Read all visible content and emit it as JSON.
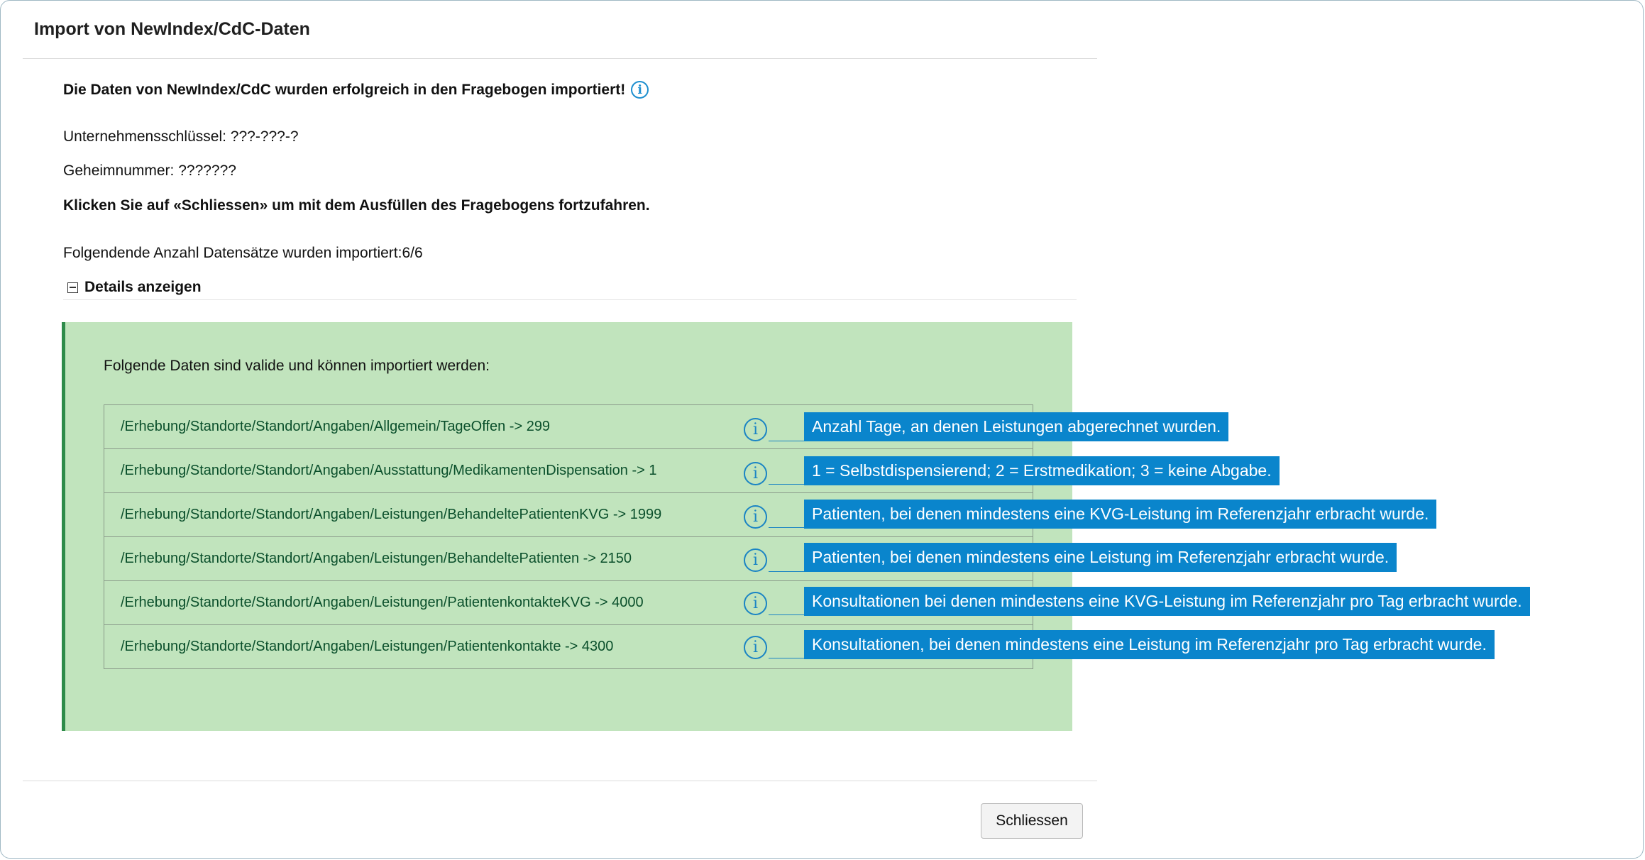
{
  "dialog": {
    "title": "Import von NewIndex/CdC-Daten"
  },
  "summary": {
    "success_message": "Die Daten von NewIndex/CdC wurden erfolgreich in den Fragebogen importiert!",
    "company_key": "Unternehmensschlüssel: ???-???-?",
    "secret_number": "Geheimnummer: ???????",
    "hint": "Klicken Sie auf «Schliessen» um mit dem Ausfüllen des Fragebogens fortzufahren.",
    "record_count": "Folgendende Anzahl Datensätze wurden importiert:6/6"
  },
  "details": {
    "toggle_label": "Details anzeigen",
    "valid_heading": "Folgende Daten sind valide und können importiert werden:",
    "rows": [
      {
        "path": "/Erhebung/Standorte/Standort/Angaben/Allgemein/TageOffen -> 299",
        "tooltip": "Anzahl Tage, an denen Leistungen abgerechnet wurden."
      },
      {
        "path": "/Erhebung/Standorte/Standort/Angaben/Ausstattung/MedikamentenDispensation -> 1",
        "tooltip": "1 = Selbstdispensierend; 2 = Erstmedikation; 3 = keine Abgabe."
      },
      {
        "path": "/Erhebung/Standorte/Standort/Angaben/Leistungen/BehandeltePatientenKVG -> 1999",
        "tooltip": "Patienten, bei denen mindestens eine KVG-Leistung im Referenzjahr erbracht wurde."
      },
      {
        "path": "/Erhebung/Standorte/Standort/Angaben/Leistungen/BehandeltePatienten -> 2150",
        "tooltip": "Patienten, bei denen mindestens eine Leistung im Referenzjahr erbracht wurde."
      },
      {
        "path": "/Erhebung/Standorte/Standort/Angaben/Leistungen/PatientenkontakteKVG -> 4000",
        "tooltip": "Konsultationen bei denen mindestens eine KVG-Leistung im Referenzjahr pro Tag erbracht wurde."
      },
      {
        "path": "/Erhebung/Standorte/Standort/Angaben/Leistungen/Patientenkontakte -> 4300",
        "tooltip": "Konsultationen, bei denen mindestens eine Leistung im Referenzjahr pro Tag erbracht wurde."
      }
    ]
  },
  "footer": {
    "close_label": "Schliessen"
  },
  "icons": {
    "info_glyph": "i",
    "info_color": "#1a84c4",
    "tooltip_color": "#0a85cc",
    "panel_color": "#c1e4bd",
    "panel_border_color": "#2e8b4a"
  }
}
